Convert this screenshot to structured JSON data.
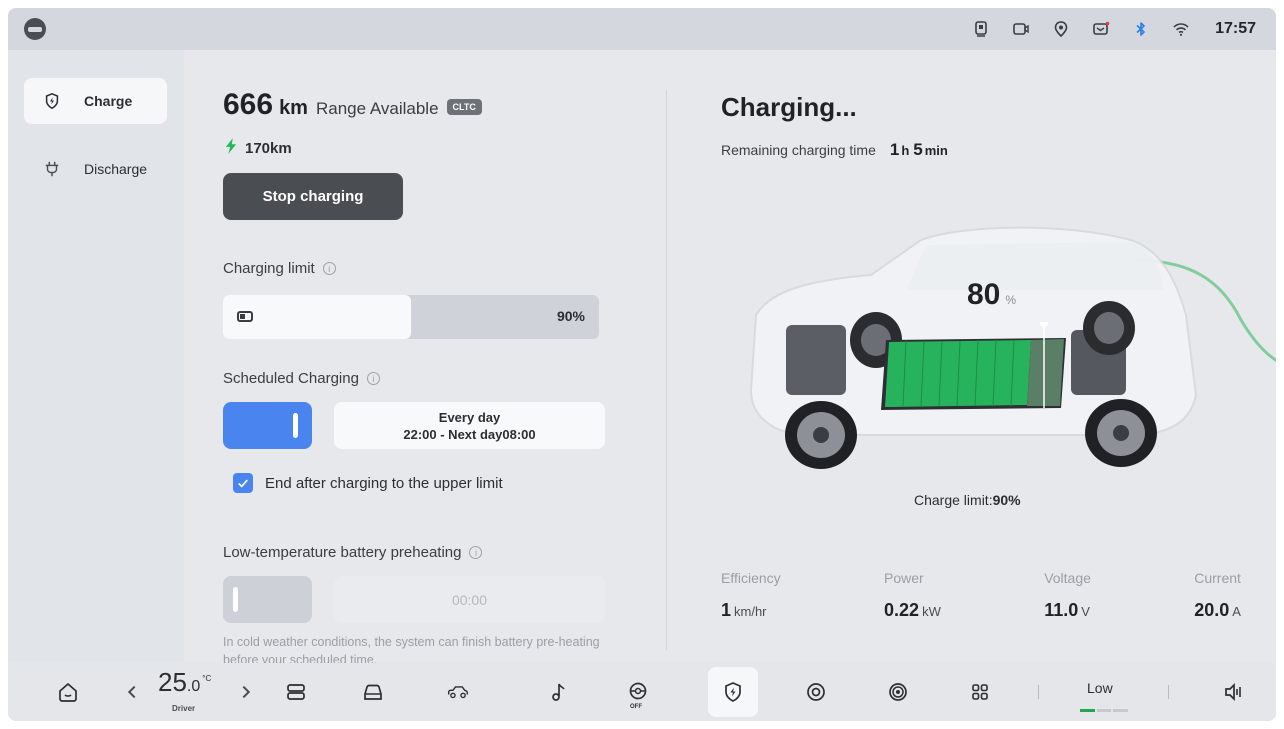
{
  "status_bar": {
    "time": "17:57",
    "icons": [
      "phone-card-icon",
      "camera-icon",
      "location-icon",
      "message-icon",
      "bluetooth-icon",
      "wifi-icon"
    ]
  },
  "sidebar": {
    "items": [
      {
        "label": "Charge",
        "icon": "charge-shield-icon",
        "active": true
      },
      {
        "label": "Discharge",
        "icon": "plug-icon",
        "active": false
      }
    ]
  },
  "range": {
    "value": "666",
    "unit": "km",
    "label": "Range Available",
    "badge": "CLTC",
    "added": "170km"
  },
  "stop_button": "Stop charging",
  "charging_limit": {
    "title": "Charging limit",
    "value_text": "90%",
    "fraction": 0.5
  },
  "scheduled": {
    "title": "Scheduled Charging",
    "enabled": true,
    "line1": "Every day",
    "line2": "22:00 - Next day08:00",
    "end_after_label": "End after charging to the upper limit"
  },
  "preheating": {
    "title": "Low-temperature battery preheating",
    "time": "00:00",
    "description": "In cold weather conditions, the system can finish battery pre-heating before your scheduled time."
  },
  "charging": {
    "title": "Charging...",
    "remaining_label": "Remaining charging time",
    "hours": "1",
    "hours_unit": "h",
    "minutes": "5",
    "minutes_unit": "min",
    "percent": "80",
    "percent_unit": "%",
    "charge_limit_label": "Charge limit:",
    "charge_limit_value": "90%"
  },
  "stats": [
    {
      "label": "Efficiency",
      "value": "1",
      "unit": "km/hr"
    },
    {
      "label": "Power",
      "value": "0.22",
      "unit": "kW"
    },
    {
      "label": "Voltage",
      "value": "11.0",
      "unit": "V"
    },
    {
      "label": "Current",
      "value": "20.0",
      "unit": "A"
    }
  ],
  "dock": {
    "temp_int": "25",
    "temp_dec": ".0",
    "temp_unit": "°C",
    "temp_label": "Driver",
    "off_label": "OFF",
    "fan_level": "Low"
  },
  "colors": {
    "accent_blue": "#4a84ef",
    "battery_green": "#22b85a",
    "dark_button": "#4a4d52"
  }
}
